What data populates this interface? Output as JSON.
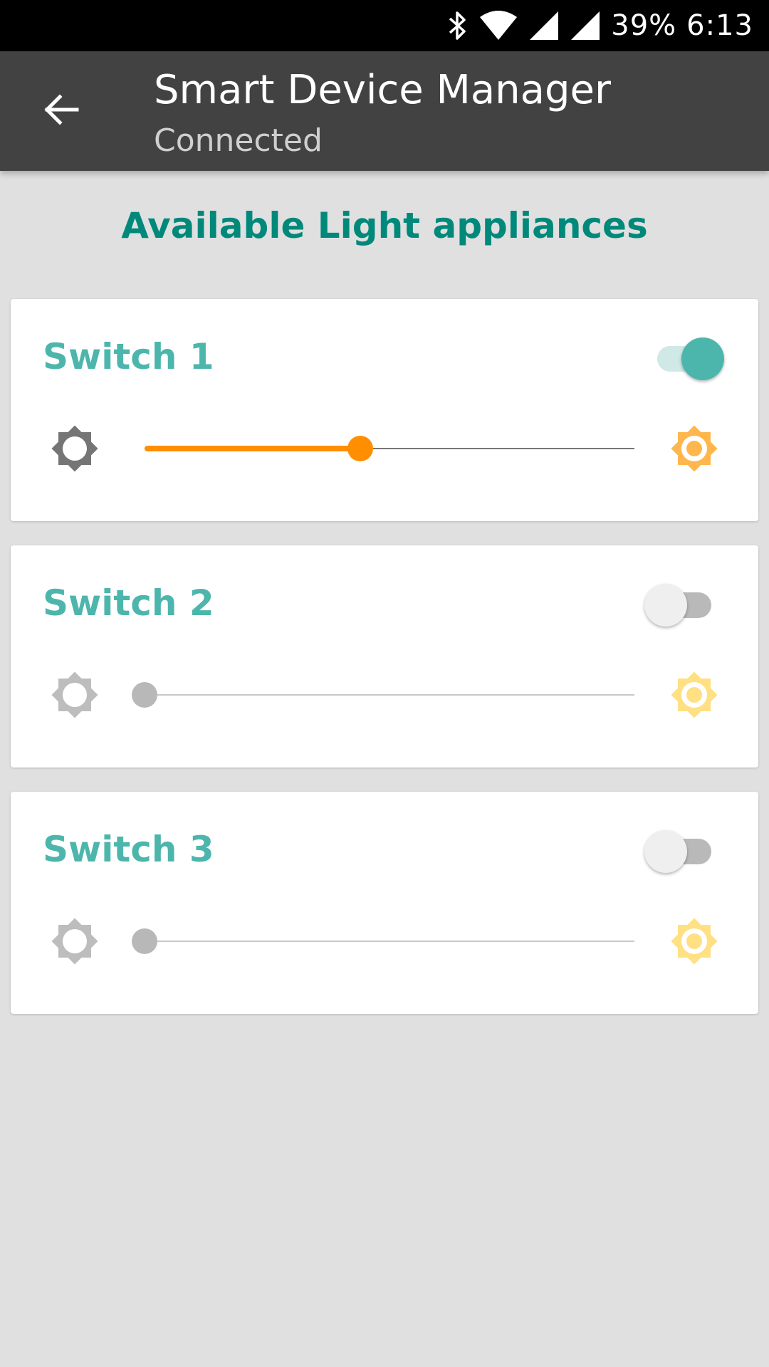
{
  "status_bar": {
    "battery": "39%",
    "time": "6:13",
    "icons": [
      "bluetooth-icon",
      "wifi-icon",
      "signal-icon",
      "signal-icon"
    ]
  },
  "app_bar": {
    "title": "Smart Device Manager",
    "subtitle": "Connected",
    "back_icon": "arrow-back-icon"
  },
  "section": {
    "heading": "Available Light appliances"
  },
  "colors": {
    "accent": "#00897b",
    "switch_title": "#4db6ac",
    "slider_active": "#ff8f00",
    "app_bar": "#424242",
    "background": "#e0e0e0"
  },
  "switches": [
    {
      "label": "Switch 1",
      "on": true,
      "brightness_fraction": 0.44,
      "low_icon": "brightness-low-icon",
      "high_icon": "brightness-high-icon",
      "low_color": "#757575",
      "high_color": "#ffb74d"
    },
    {
      "label": "Switch 2",
      "on": false,
      "brightness_fraction": 0.0,
      "low_icon": "brightness-low-icon",
      "high_icon": "brightness-high-icon",
      "low_color": "#bdbdbd",
      "high_color": "#ffe082"
    },
    {
      "label": "Switch 3",
      "on": false,
      "brightness_fraction": 0.0,
      "low_icon": "brightness-low-icon",
      "high_icon": "brightness-high-icon",
      "low_color": "#bdbdbd",
      "high_color": "#ffe082"
    }
  ]
}
